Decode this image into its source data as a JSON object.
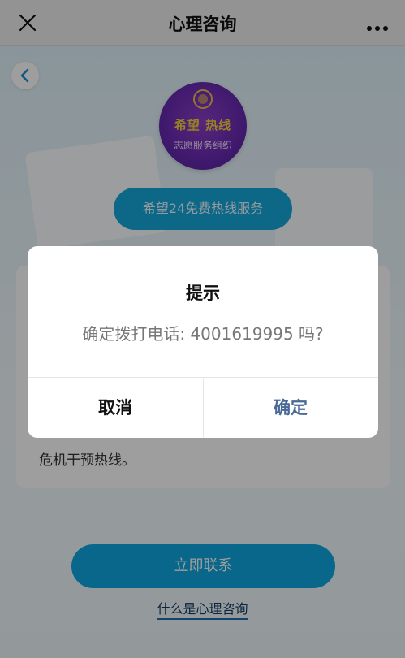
{
  "header": {
    "title": "心理咨询",
    "close_icon": "close-icon",
    "more_icon": "more-dots-icon"
  },
  "page": {
    "back_icon": "chevron-left-icon",
    "logo": {
      "line1": "希望 热线",
      "line2": "志愿服务组织"
    },
    "hotline_label": "希望24免费热线服务",
    "card_text": "危机干预热线。",
    "call_button_label": "立即联系",
    "about_link_label": "什么是心理咨询"
  },
  "dialog": {
    "title": "提示",
    "message": "确定拨打电话: 4001619995 吗?",
    "cancel_label": "取消",
    "confirm_label": "确定"
  },
  "colors": {
    "accent": "#15a6da",
    "confirm_text": "#4a6a96",
    "logo_purple": "#6b2bb3",
    "logo_gold": "#f5d23a"
  }
}
